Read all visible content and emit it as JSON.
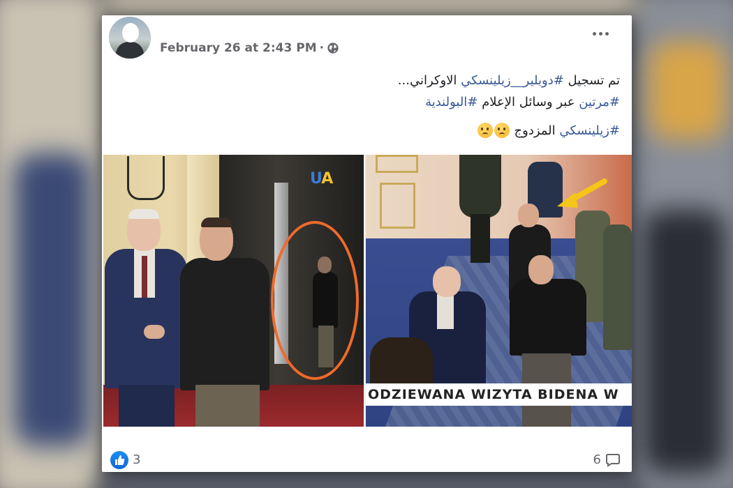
{
  "post": {
    "timestamp": "February 26 at 2:43 PM",
    "separator": "·",
    "privacy_icon": "globe-icon",
    "menu_icon": "more-options-icon",
    "text": {
      "line1_plain_a": "تم تسجيل ",
      "line1_tag": "#دوبلير__زيلينسكي",
      "line1_plain_b": " الاوكراني...",
      "line2_tag_a": "#مرتين",
      "line2_plain": " عبر وسائل الإعلام ",
      "line2_tag_b": "#البولندية",
      "line3_tag": "#زيلينسكي",
      "line3_plain": " المزدوج "
    }
  },
  "photos": {
    "left_logo_u": "U",
    "left_logo_a": "A",
    "right_banner": "ODZIEWANA WIZYTA BIDENA W"
  },
  "footer": {
    "reaction_icon": "like-icon",
    "reaction_count": "3",
    "comment_count": "6",
    "comment_icon": "comment-icon"
  },
  "colors": {
    "link": "#385898",
    "circle_annotation": "#f06a2a",
    "arrow_annotation": "#f5c518",
    "like": "#1877f2"
  }
}
